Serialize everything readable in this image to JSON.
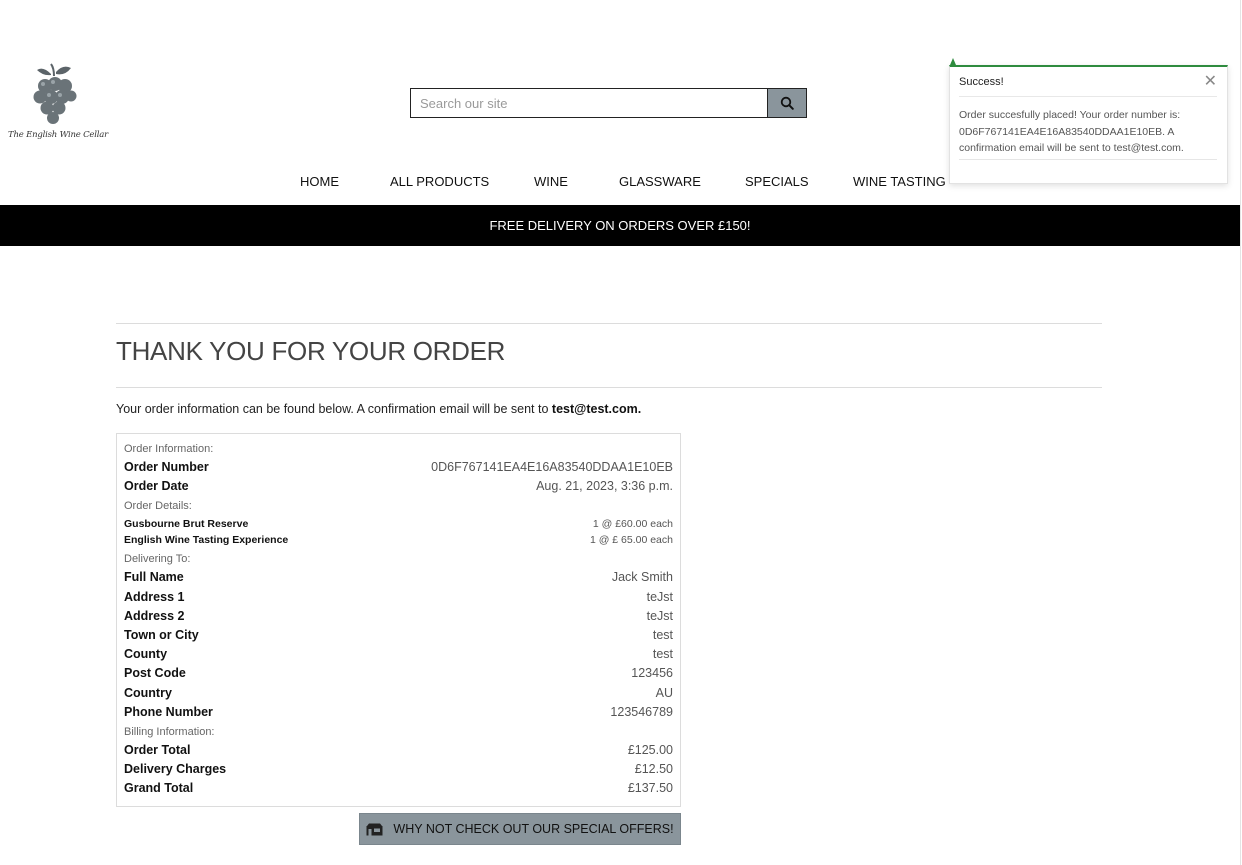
{
  "logo": {
    "text": "The English Wine Cellar",
    "icon": "grapes-icon"
  },
  "search": {
    "placeholder": "Search our site",
    "button_icon": "search-icon"
  },
  "nav": {
    "items": [
      "HOME",
      "ALL PRODUCTS",
      "WINE",
      "GLASSWARE",
      "SPECIALS",
      "WINE TASTING"
    ]
  },
  "banner": {
    "text": "FREE DELIVERY ON ORDERS OVER £150!"
  },
  "page": {
    "title": "THANK YOU FOR YOUR ORDER",
    "intro": "Your order information can be found below. A confirmation email will be sent to ",
    "email": "test@test.com."
  },
  "order": {
    "order_info_heading": "Order Information:",
    "order_number_label": "Order Number",
    "order_number": "0D6F767141EA4E16A83540DDAA1E10EB",
    "order_date_label": "Order Date",
    "order_date": "Aug. 21, 2023, 3:36 p.m.",
    "order_details_heading": "Order Details:",
    "items": [
      {
        "name": "Gusbourne Brut Reserve",
        "qty_price": "1 @ £60.00 each"
      },
      {
        "name": "English Wine Tasting Experience",
        "qty_price": "1 @ £ 65.00 each"
      }
    ],
    "delivering_heading": "Delivering To:",
    "delivery": [
      {
        "label": "Full Name",
        "value": "Jack Smith"
      },
      {
        "label": "Address 1",
        "value": "teJst"
      },
      {
        "label": "Address 2",
        "value": "teJst"
      },
      {
        "label": "Town or City",
        "value": "test"
      },
      {
        "label": "County",
        "value": "test"
      },
      {
        "label": "Post Code",
        "value": "123456"
      },
      {
        "label": "Country",
        "value": "AU"
      },
      {
        "label": "Phone Number",
        "value": "123546789"
      }
    ],
    "billing_heading": "Billing Information:",
    "billing": [
      {
        "label": "Order Total",
        "value": "£125.00"
      },
      {
        "label": "Delivery Charges",
        "value": "£12.50"
      },
      {
        "label": "Grand Total",
        "value": "£137.50"
      }
    ]
  },
  "special_button": {
    "label": "WHY NOT CHECK OUT OUR SPECIAL OFFERS!",
    "icon": "shop-icon"
  },
  "toast": {
    "title": "Success!",
    "message": "Order succesfully placed! Your order number is: 0D6F767141EA4E16A83540DDAA1E10EB. A confirmation email will be sent to test@test.com.",
    "close_icon": "close-icon",
    "accent": "#2e8b3e"
  },
  "colors": {
    "button_bg": "#8a959c",
    "banner_bg": "#000000"
  }
}
